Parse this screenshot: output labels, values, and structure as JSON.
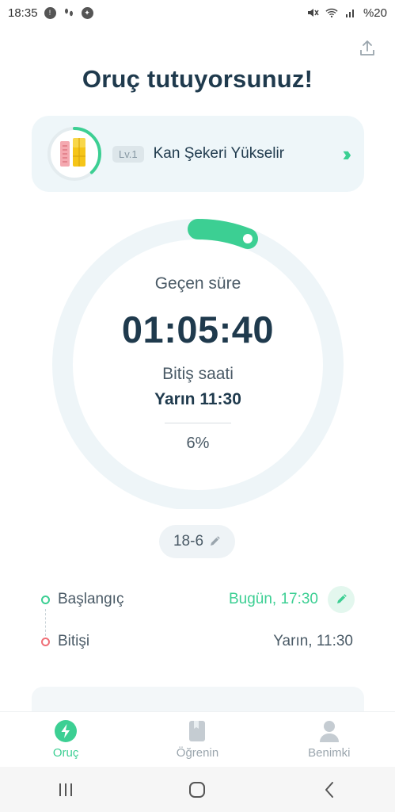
{
  "status_bar": {
    "time": "18:35",
    "battery": "%20",
    "left_icons": [
      "alert-circle-icon",
      "footprints-icon",
      "pin-icon"
    ],
    "right_icons": [
      "mute-icon",
      "wifi-icon",
      "signal-icon"
    ]
  },
  "header": {
    "title": "Oruç tutuyorsunuz!",
    "share_icon": "share-icon"
  },
  "level_card": {
    "badge": "Lv.1",
    "title": "Kan Şekeri Yükselir",
    "progress": 0.38,
    "accent_color": "#3ccf93"
  },
  "timer": {
    "elapsed_label": "Geçen süre",
    "elapsed_value": "01:05:40",
    "end_label": "Bitiş saati",
    "end_value": "Yarın 11:30",
    "percent_text": "6%",
    "progress": 0.06,
    "ring_color": "#eef5f8",
    "progress_color": "#3ccf93"
  },
  "plan": {
    "label": "18-6"
  },
  "schedule": {
    "start_label": "Başlangıç",
    "start_value": "Bugün, 17:30",
    "end_label": "Bitişi",
    "end_value": "Yarın, 11:30"
  },
  "tabs": [
    {
      "label": "Oruç",
      "icon": "bolt-icon",
      "active": true
    },
    {
      "label": "Öğrenin",
      "icon": "book-icon",
      "active": false
    },
    {
      "label": "Benimki",
      "icon": "profile-icon",
      "active": false
    }
  ],
  "colors": {
    "accent": "#3ccf93",
    "text_dark": "#1f3a4d",
    "end_dot": "#ef6f77"
  }
}
